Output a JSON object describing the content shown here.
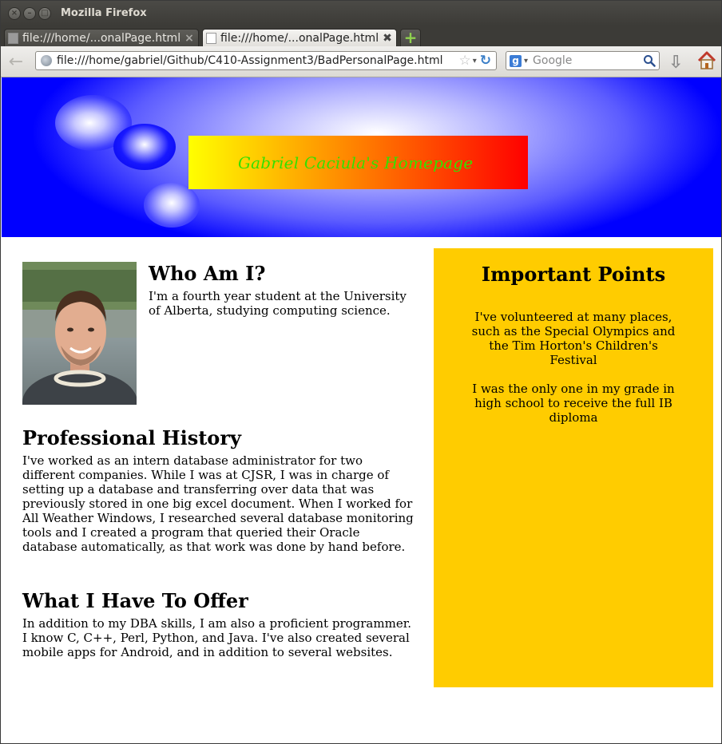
{
  "window": {
    "title": "Mozilla Firefox",
    "controls": {
      "close": "×",
      "minimize": "–",
      "maximize": "□"
    }
  },
  "tabs": [
    {
      "label": "file:///home/...onalPage.html",
      "active": false,
      "close": "×"
    },
    {
      "label": "file:///home/...onalPage.html",
      "active": true,
      "close": "✖"
    }
  ],
  "new_tab_label": "+",
  "navigation": {
    "back_glyph": "←",
    "url": "file:///home/gabriel/Github/C410-Assignment3/BadPersonalPage.html",
    "bookmark_glyph": "☆",
    "dropdown_glyph": "▾",
    "reload_glyph": "↻",
    "search_engine_glyph": "g",
    "search_placeholder": "Google",
    "download_glyph": "⇩"
  },
  "colors": {
    "banner_blue": "#0000ff",
    "title_gradient_start": "#ffff00",
    "title_gradient_end": "#ff0000",
    "title_text": "#35e000",
    "sidebar_bg": "#ffcc00"
  },
  "page": {
    "banner_title": "Gabriel Caciula's Homepage",
    "who": {
      "heading": "Who Am I?",
      "text": "I'm a fourth year student at the University of Alberta, studying computing science."
    },
    "professional": {
      "heading": "Professional History",
      "text": "I've worked as an intern database administrator for two different companies. While I was at CJSR, I was in charge of setting up a database and transferring over data that was previously stored in one big excel document. When I worked for All Weather Windows, I researched several database monitoring tools and I created a program that queried their Oracle database automatically, as that work was done by hand before."
    },
    "offer": {
      "heading": "What I Have To Offer",
      "text": "In addition to my DBA skills, I am also a proficient programmer. I know C, C++, Perl, Python, and Java. I've also created several mobile apps for Android, and in addition to several websites."
    },
    "sidebar": {
      "heading": "Important Points",
      "points": [
        "I've volunteered at many places, such as the Special Olympics and the Tim Horton's Children's Festival",
        "I was the only one in my grade in high school to receive the full IB diploma"
      ]
    }
  }
}
